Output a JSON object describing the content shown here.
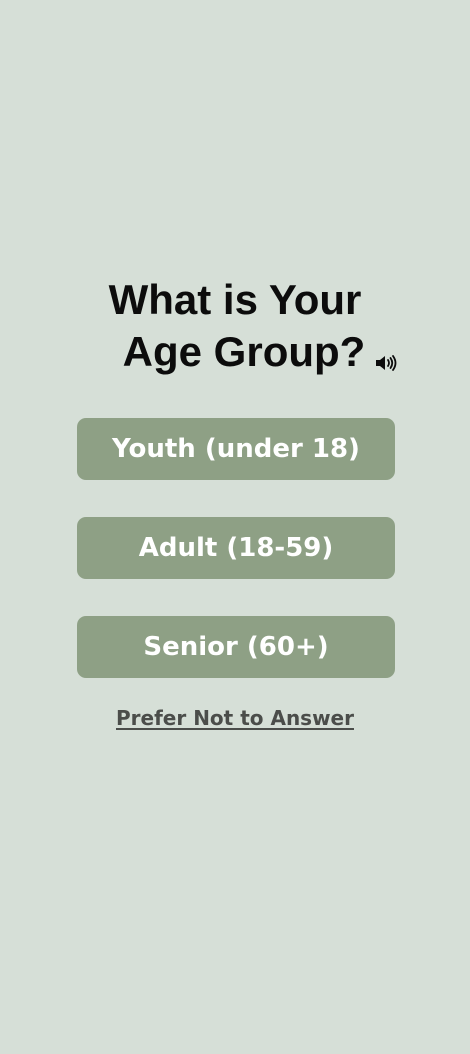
{
  "question": {
    "line1": "What is Your",
    "line2": "Age Group?",
    "audio_icon": "speaker-icon"
  },
  "options": [
    {
      "label": "Youth (under 18)"
    },
    {
      "label": "Adult (18-59)"
    },
    {
      "label": "Senior (60+)"
    }
  ],
  "skip": {
    "label": "Prefer Not to Answer"
  },
  "colors": {
    "background": "#d6dfd7",
    "button": "#8ea085",
    "button_text": "#ffffff",
    "heading_text": "#0c0c0c",
    "link_text": "#4b4d4a"
  }
}
